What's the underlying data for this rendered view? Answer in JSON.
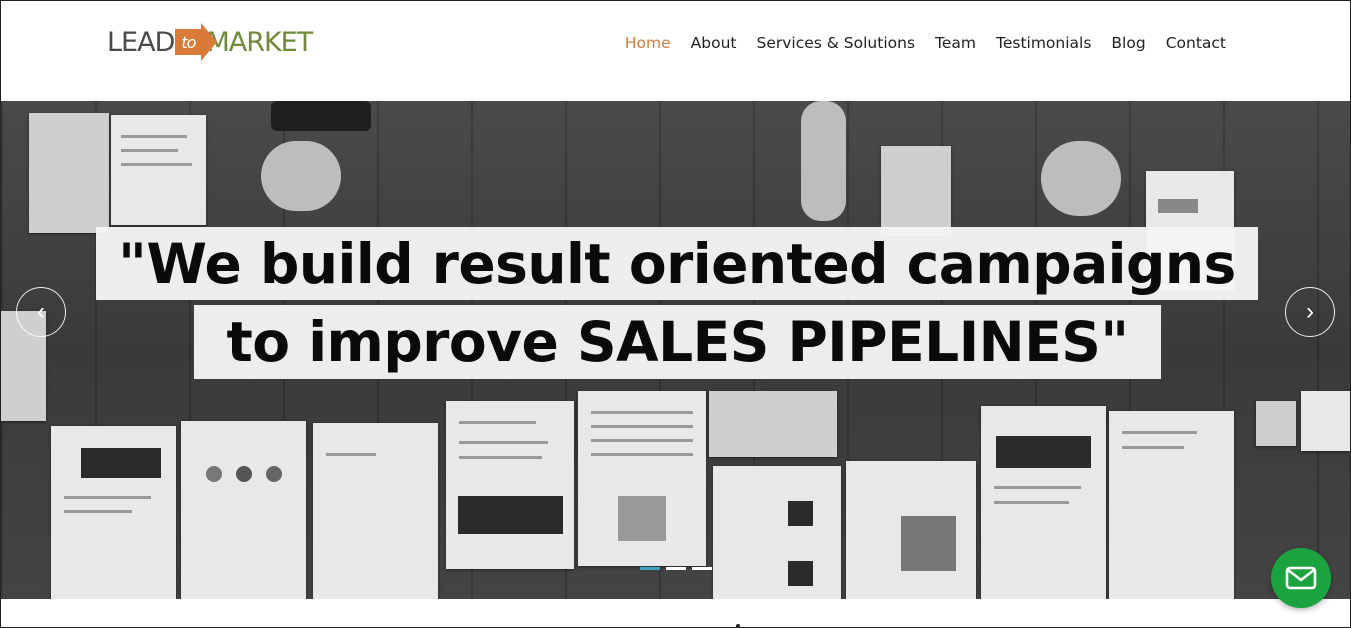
{
  "header": {
    "logo": {
      "part1": "LEAD",
      "part2": "to",
      "part3": "MARKET",
      "colors": {
        "lead": "#4a4a4a",
        "to_bg": "#d97b38",
        "market": "#6e8a3a"
      }
    },
    "nav": [
      {
        "label": "Home",
        "active": true
      },
      {
        "label": "About",
        "active": false
      },
      {
        "label": "Services & Solutions",
        "active": false
      },
      {
        "label": "Team",
        "active": false
      },
      {
        "label": "Testimonials",
        "active": false
      },
      {
        "label": "Blog",
        "active": false
      },
      {
        "label": "Contact",
        "active": false
      }
    ],
    "active_color": "#d97b38"
  },
  "hero": {
    "headline_line1": "\"We build result oriented campaigns",
    "headline_line2": "to improve SALES PIPELINES\"",
    "prev_icon": "chevron-left-icon",
    "next_icon": "chevron-right-icon",
    "prev_glyph": "‹",
    "next_glyph": "›",
    "slides_count": 3,
    "active_slide": 1,
    "indicator_active_color": "#3aa3c2"
  },
  "chat": {
    "icon": "mail-icon",
    "color": "#1aa33f"
  }
}
